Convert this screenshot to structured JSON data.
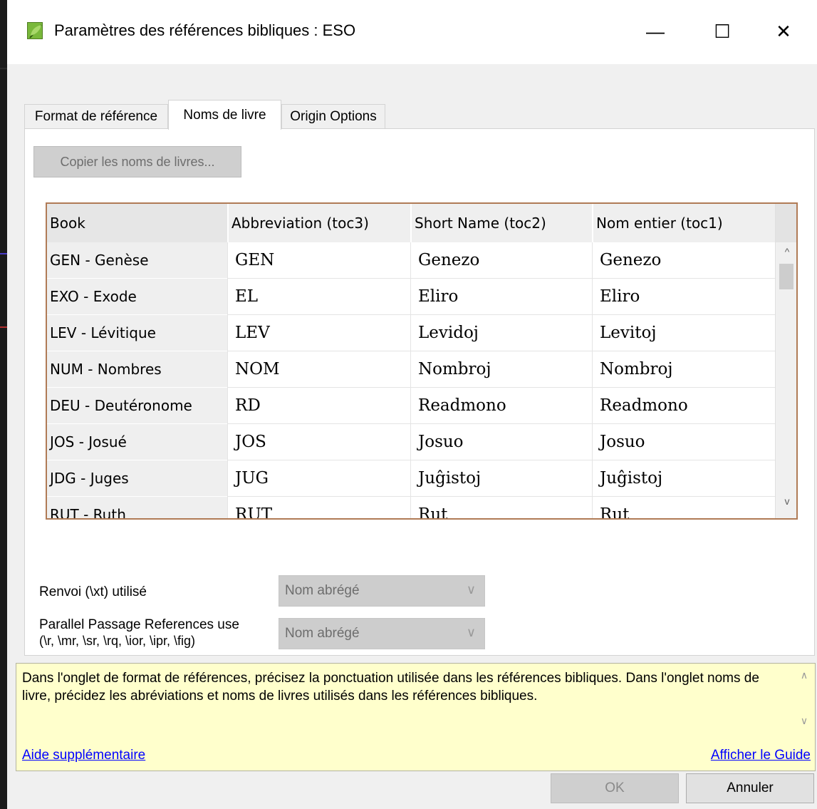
{
  "window": {
    "title": "Paramètres des références bibliques : ESO",
    "app_icon": "paratext-leaf-icon",
    "controls": {
      "minimize": "—",
      "maximize": "☐",
      "close": "✕"
    }
  },
  "tabs": [
    {
      "label": "Format de référence",
      "active": false
    },
    {
      "label": "Noms de livre",
      "active": true
    },
    {
      "label": "Origin Options",
      "active": false
    }
  ],
  "copy_button": {
    "label": "Copier les noms de livres...",
    "enabled": false
  },
  "grid": {
    "columns": [
      "Book",
      "Abbreviation (toc3)",
      "Short Name (toc2)",
      "Nom entier (toc1)"
    ],
    "rows": [
      {
        "book": "GEN - Genèse",
        "abbr": "GEN",
        "short": "Genezo",
        "full": "Genezo"
      },
      {
        "book": "EXO - Exode",
        "abbr": "EL",
        "short": "Eliro",
        "full": "Eliro"
      },
      {
        "book": "LEV - Lévitique",
        "abbr": "LEV",
        "short": "Levidoj",
        "full": "Levitoj"
      },
      {
        "book": "NUM - Nombres",
        "abbr": "NOM",
        "short": "Nombroj",
        "full": "Nombroj"
      },
      {
        "book": "DEU - Deutéronome",
        "abbr": "RD",
        "short": "Readmono",
        "full": "Readmono"
      },
      {
        "book": "JOS - Josué",
        "abbr": "JOS",
        "short": "Josuo",
        "full": "Josuo"
      },
      {
        "book": "JDG - Juges",
        "abbr": "JUG",
        "short": "Juĝistoj",
        "full": "Juĝistoj"
      },
      {
        "book": "RUT - Ruth",
        "abbr": "RUT",
        "short": "Rut",
        "full": "Rut"
      }
    ],
    "scroll_up": "^",
    "scroll_down": "v"
  },
  "xref": {
    "label": "Renvoi (\\xt) utilisé",
    "value": "Nom abrégé",
    "enabled": false
  },
  "parallel": {
    "label_line1": "Parallel Passage References use",
    "label_line2": "(\\r, \\mr, \\sr, \\rq, \\ior, \\ipr, \\fig)",
    "value": "Nom abrégé",
    "enabled": false
  },
  "help": {
    "text": "Dans l'onglet de format de références, précisez la ponctuation utilisée dans les références bibliques. Dans l'onglet noms de livre, précidez les abréviations et noms de livres utilisés dans les références bibliques.",
    "more_help": "Aide supplémentaire",
    "show_guide": "Afficher le Guide"
  },
  "buttons": {
    "ok": "OK",
    "cancel": "Annuler"
  },
  "colors": {
    "help_bg": "#ffffcc",
    "grid_border": "#b07b56",
    "link": "#0000ff"
  }
}
